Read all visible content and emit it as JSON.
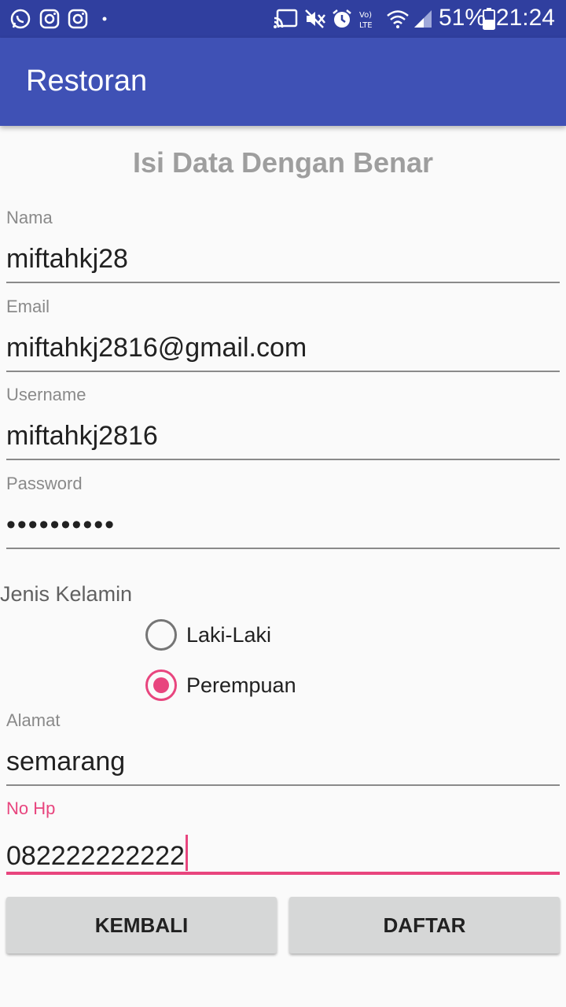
{
  "status_bar": {
    "left_icons": [
      "whatsapp-icon",
      "instagram-icon",
      "instagram-icon",
      "dot-icon"
    ],
    "right_icons": [
      "cast-icon",
      "mute-icon",
      "alarm-icon",
      "volte-icon",
      "wifi-icon",
      "signal-icon"
    ],
    "battery_percent": "51%",
    "time": "21:24"
  },
  "app_bar": {
    "title": "Restoran"
  },
  "form": {
    "title": "Isi Data Dengan Benar",
    "nama": {
      "label": "Nama",
      "value": "miftahkj28"
    },
    "email": {
      "label": "Email",
      "value": "miftahkj2816@gmail.com"
    },
    "username": {
      "label": "Username",
      "value": "miftahkj2816"
    },
    "password": {
      "label": "Password",
      "value": "••••••••••"
    },
    "gender": {
      "label": "Jenis Kelamin",
      "options": [
        "Laki-Laki",
        "Perempuan"
      ],
      "selected": "Perempuan"
    },
    "alamat": {
      "label": "Alamat",
      "value": "semarang"
    },
    "no_hp": {
      "label": "No Hp",
      "value": "082222222222"
    }
  },
  "buttons": {
    "back": "KEMBALI",
    "register": "DAFTAR"
  },
  "colors": {
    "primary": "#3f51b5",
    "primary_dark": "#303f9f",
    "accent": "#e8457e"
  }
}
